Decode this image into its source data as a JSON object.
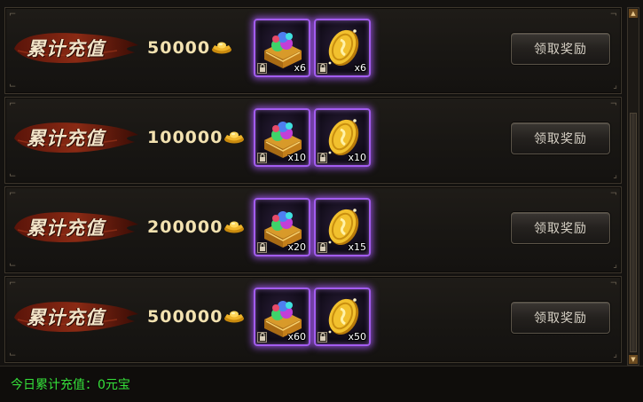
{
  "banner_label": "累计充值",
  "claim_label": "领取奖励",
  "rewards": [
    {
      "amount": "50000",
      "gift_qty": "x6",
      "coin_qty": "x6"
    },
    {
      "amount": "100000",
      "gift_qty": "x10",
      "coin_qty": "x10"
    },
    {
      "amount": "200000",
      "gift_qty": "x20",
      "coin_qty": "x15"
    },
    {
      "amount": "500000",
      "gift_qty": "x60",
      "coin_qty": "x50"
    }
  ],
  "footer": {
    "today_total": "今日累计充值：0元宝"
  },
  "icons": {
    "currency": "gold-ingot-icon",
    "item1": "gem-chest-icon",
    "item2": "gold-coin-icon",
    "lock": "lock-icon"
  },
  "colors": {
    "item_glow": "#a35cf0",
    "footer_text": "#35e03a",
    "amount_text": "#f3e2b0",
    "banner": "#7a1d10"
  }
}
